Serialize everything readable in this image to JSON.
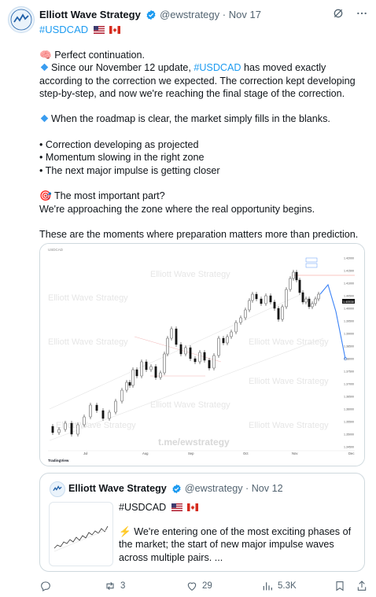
{
  "author": {
    "name": "Elliott Wave Strategy",
    "handle": "@ewstrategy",
    "separator": "·",
    "date": "Nov 17",
    "avatar_text": "ELLIOTT WAVE"
  },
  "hashtag_line": "#USDCAD",
  "body": {
    "line1_emoji": "🧠",
    "line1": "Perfect continuation.",
    "p2_prefix": "Since our November 12 update, ",
    "p2_link": "#USDCAD",
    "p2_rest": " has moved exactly according to the correction we expected. The correction kept developing step-by-step, and now we're reaching the final stage of the correction.",
    "p3": "When the roadmap is clear, the market simply fills in the blanks.",
    "bullets": [
      "• Correction developing as projected",
      "• Momentum slowing in the right zone",
      "• The next major impulse is getting closer"
    ],
    "target_emoji": "🎯",
    "p5a": "The most important part?",
    "p5b": "We're approaching the zone where the real opportunity begins.",
    "p6": "These are the moments where preparation matters more than prediction."
  },
  "chart": {
    "header": "USDCAD",
    "watermarks": [
      "Elliott Wave Strategy",
      "t.me/ewstrategy"
    ],
    "x_ticks": [
      "Jul",
      "Aug",
      "Sep",
      "Oct",
      "Nov",
      "Dec"
    ],
    "y_ticks": [
      "1.42000",
      "1.41500",
      "1.41000",
      "1.40500",
      "1.40000",
      "1.39500",
      "1.39000",
      "1.38500",
      "1.38000",
      "1.37500",
      "1.37000",
      "1.36500",
      "1.36000",
      "1.35500",
      "1.35000",
      "1.34500"
    ],
    "price_tag": "1.40538",
    "brand": "TradingView",
    "price_color": "#141414",
    "projection_color": "#3b82f6"
  },
  "quote": {
    "name": "Elliott Wave Strategy",
    "handle": "@ewstrategy",
    "separator": "·",
    "date": "Nov 12",
    "hashtag": "#USDCAD",
    "emoji": "⚡",
    "text": "We're entering one of the most exciting phases of the market; the start of new major impulse waves across multiple pairs. ..."
  },
  "actions": {
    "retweets": "3",
    "likes": "29",
    "views": "5.3K"
  },
  "colors": {
    "link": "#1d9bf0",
    "muted": "#536471",
    "verified": "#1d9bf0"
  }
}
